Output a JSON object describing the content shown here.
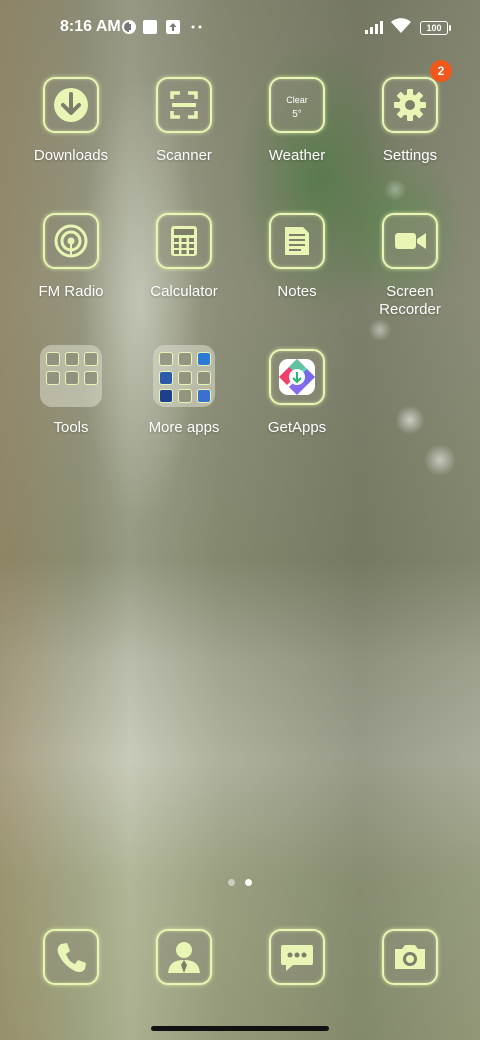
{
  "status_bar": {
    "time": "8:16 AM",
    "battery": "100"
  },
  "apps": [
    {
      "label": "Downloads",
      "icon": "download-arrow-icon"
    },
    {
      "label": "Scanner",
      "icon": "scan-frame-icon"
    },
    {
      "label": "Weather",
      "icon": "weather-icon"
    },
    {
      "label": "Settings",
      "icon": "gear-icon",
      "badge": "2"
    },
    {
      "label": "FM Radio",
      "icon": "radio-icon"
    },
    {
      "label": "Calculator",
      "icon": "calculator-icon"
    },
    {
      "label": "Notes",
      "icon": "note-icon"
    },
    {
      "label": "Screen Recorder",
      "icon": "video-camera-icon"
    },
    {
      "label": "Tools",
      "icon": "folder-icon"
    },
    {
      "label": "More apps",
      "icon": "folder-icon"
    },
    {
      "label": "GetApps",
      "icon": "getapps-icon"
    }
  ],
  "weather_widget": {
    "condition": "Clear",
    "temperature": "5°"
  },
  "dock": [
    {
      "icon": "phone-icon"
    },
    {
      "icon": "contacts-icon"
    },
    {
      "icon": "messages-icon"
    },
    {
      "icon": "camera-icon"
    }
  ],
  "page_indicator": {
    "pages": 2,
    "current": 2
  },
  "colors": {
    "icon_border": "#e8f5b5",
    "badge": "#f0581c"
  }
}
